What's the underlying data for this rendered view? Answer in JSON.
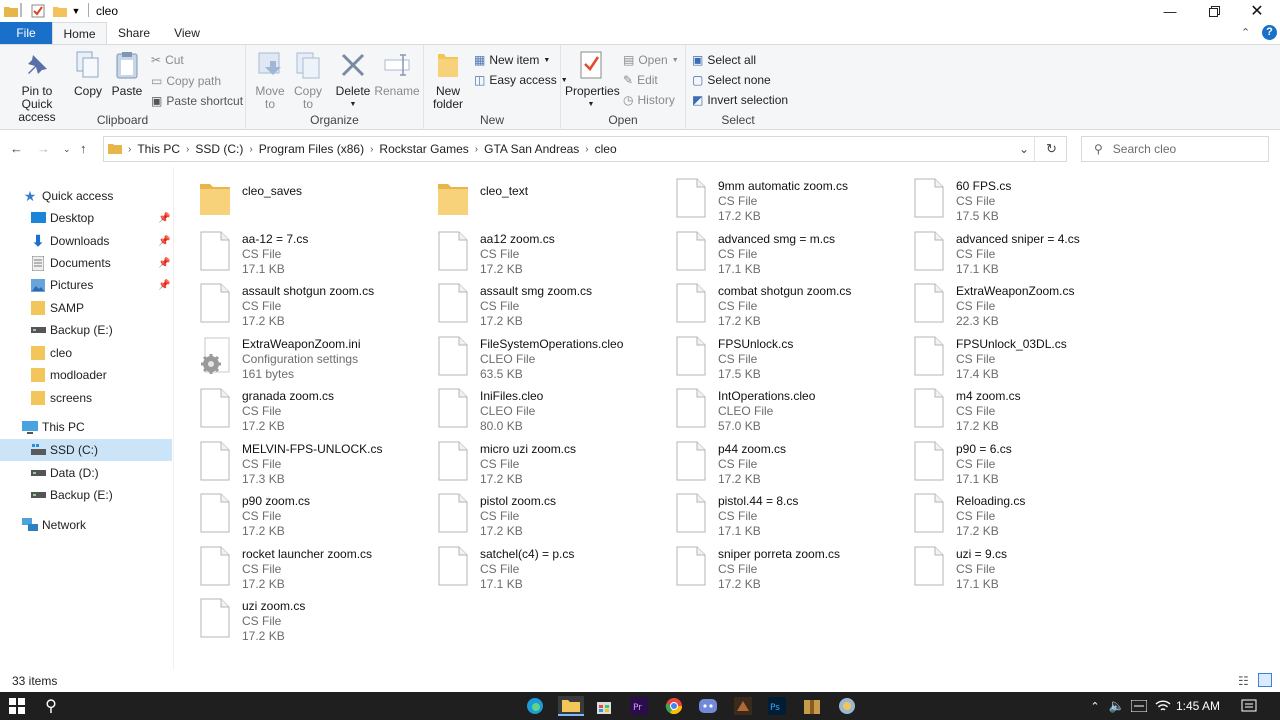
{
  "window": {
    "title": "cleo"
  },
  "tabs": {
    "file": "File",
    "home": "Home",
    "share": "Share",
    "view": "View"
  },
  "ribbon": {
    "clipboard": {
      "pin": "Pin to Quick access",
      "copy": "Copy",
      "paste": "Paste",
      "cut": "Cut",
      "copy_path": "Copy path",
      "paste_shortcut": "Paste shortcut",
      "label": "Clipboard"
    },
    "organize": {
      "move_to": "Move to",
      "copy_to": "Copy to",
      "delete": "Delete",
      "rename": "Rename",
      "label": "Organize"
    },
    "new": {
      "new_folder": "New folder",
      "new_item": "New item",
      "easy_access": "Easy access",
      "label": "New"
    },
    "open": {
      "properties": "Properties",
      "open": "Open",
      "edit": "Edit",
      "history": "History",
      "label": "Open"
    },
    "select": {
      "select_all": "Select all",
      "select_none": "Select none",
      "invert": "Invert selection",
      "label": "Select"
    }
  },
  "address": {
    "crumbs": [
      "This PC",
      "SSD (C:)",
      "Program Files (x86)",
      "Rockstar Games",
      "GTA San Andreas",
      "cleo"
    ],
    "search_placeholder": "Search cleo"
  },
  "nav": {
    "quick_access": "Quick access",
    "quick_items": [
      "Desktop",
      "Downloads",
      "Documents",
      "Pictures",
      "SAMP",
      "Backup (E:)",
      "cleo",
      "modloader",
      "screens"
    ],
    "this_pc": "This PC",
    "drives": [
      "SSD (C:)",
      "Data (D:)",
      "Backup (E:)"
    ],
    "network": "Network"
  },
  "files": [
    {
      "name": "cleo_saves",
      "type": "",
      "size": "",
      "kind": "folder"
    },
    {
      "name": "cleo_text",
      "type": "",
      "size": "",
      "kind": "folder"
    },
    {
      "name": "9mm automatic zoom.cs",
      "type": "CS File",
      "size": "17.2 KB",
      "kind": "file"
    },
    {
      "name": "60 FPS.cs",
      "type": "CS File",
      "size": "17.5 KB",
      "kind": "file"
    },
    {
      "name": "aa-12 = 7.cs",
      "type": "CS File",
      "size": "17.1 KB",
      "kind": "file"
    },
    {
      "name": "aa12 zoom.cs",
      "type": "CS File",
      "size": "17.2 KB",
      "kind": "file"
    },
    {
      "name": "advanced smg = m.cs",
      "type": "CS File",
      "size": "17.1 KB",
      "kind": "file"
    },
    {
      "name": "advanced sniper = 4.cs",
      "type": "CS File",
      "size": "17.1 KB",
      "kind": "file"
    },
    {
      "name": "assault shotgun zoom.cs",
      "type": "CS File",
      "size": "17.2 KB",
      "kind": "file"
    },
    {
      "name": "assault smg zoom.cs",
      "type": "CS File",
      "size": "17.2 KB",
      "kind": "file"
    },
    {
      "name": "combat shotgun zoom.cs",
      "type": "CS File",
      "size": "17.2 KB",
      "kind": "file"
    },
    {
      "name": "ExtraWeaponZoom.cs",
      "type": "CS File",
      "size": "22.3 KB",
      "kind": "file"
    },
    {
      "name": "ExtraWeaponZoom.ini",
      "type": "Configuration settings",
      "size": "161 bytes",
      "kind": "ini"
    },
    {
      "name": "FileSystemOperations.cleo",
      "type": "CLEO File",
      "size": "63.5 KB",
      "kind": "file"
    },
    {
      "name": "FPSUnlock.cs",
      "type": "CS File",
      "size": "17.5 KB",
      "kind": "file"
    },
    {
      "name": "FPSUnlock_03DL.cs",
      "type": "CS File",
      "size": "17.4 KB",
      "kind": "file"
    },
    {
      "name": "granada zoom.cs",
      "type": "CS File",
      "size": "17.2 KB",
      "kind": "file"
    },
    {
      "name": "IniFiles.cleo",
      "type": "CLEO File",
      "size": "80.0 KB",
      "kind": "file"
    },
    {
      "name": "IntOperations.cleo",
      "type": "CLEO File",
      "size": "57.0 KB",
      "kind": "file"
    },
    {
      "name": "m4 zoom.cs",
      "type": "CS File",
      "size": "17.2 KB",
      "kind": "file"
    },
    {
      "name": "MELVIN-FPS-UNLOCK.cs",
      "type": "CS File",
      "size": "17.3 KB",
      "kind": "file"
    },
    {
      "name": "micro uzi zoom.cs",
      "type": "CS File",
      "size": "17.2 KB",
      "kind": "file"
    },
    {
      "name": "p44 zoom.cs",
      "type": "CS File",
      "size": "17.2 KB",
      "kind": "file"
    },
    {
      "name": "p90 = 6.cs",
      "type": "CS File",
      "size": "17.1 KB",
      "kind": "file"
    },
    {
      "name": "p90 zoom.cs",
      "type": "CS File",
      "size": "17.2 KB",
      "kind": "file"
    },
    {
      "name": "pistol zoom.cs",
      "type": "CS File",
      "size": "17.2 KB",
      "kind": "file"
    },
    {
      "name": "pistol.44 = 8.cs",
      "type": "CS File",
      "size": "17.1 KB",
      "kind": "file"
    },
    {
      "name": "Reloading.cs",
      "type": "CS File",
      "size": "17.2 KB",
      "kind": "file"
    },
    {
      "name": "rocket launcher zoom.cs",
      "type": "CS File",
      "size": "17.2 KB",
      "kind": "file"
    },
    {
      "name": "satchel(c4) = p.cs",
      "type": "CS File",
      "size": "17.1 KB",
      "kind": "file"
    },
    {
      "name": "sniper porreta zoom.cs",
      "type": "CS File",
      "size": "17.2 KB",
      "kind": "file"
    },
    {
      "name": "uzi = 9.cs",
      "type": "CS File",
      "size": "17.1 KB",
      "kind": "file"
    },
    {
      "name": "uzi zoom.cs",
      "type": "CS File",
      "size": "17.2 KB",
      "kind": "file"
    }
  ],
  "status": {
    "count": "33 items"
  },
  "taskbar": {
    "time": "1:45 AM"
  }
}
